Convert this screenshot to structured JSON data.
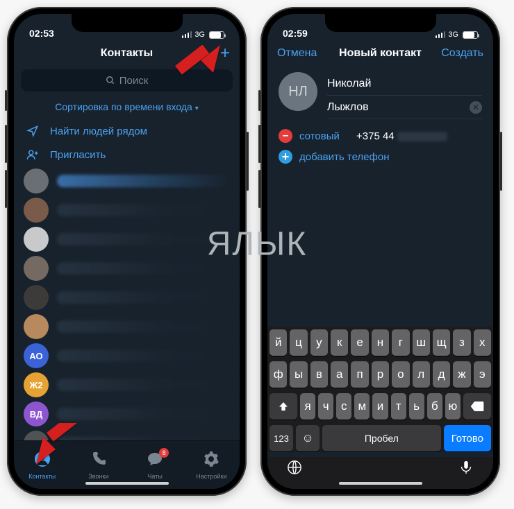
{
  "left": {
    "status": {
      "time": "02:53",
      "net": "3G"
    },
    "title": "Контакты",
    "search_placeholder": "Поиск",
    "sort_label": "Сортировка по времени входа",
    "find_nearby": "Найти людей рядом",
    "invite": "Пригласить",
    "contacts": [
      {
        "kind": "photo",
        "color": "#6b6f73",
        "highlight": true
      },
      {
        "kind": "photo",
        "color": "#7a5a48"
      },
      {
        "kind": "photo",
        "color": "#c7c9cb"
      },
      {
        "kind": "photo",
        "color": "#756a62"
      },
      {
        "kind": "photo",
        "color": "#3d3a3a"
      },
      {
        "kind": "photo",
        "color": "#b8895e"
      },
      {
        "kind": "initial",
        "color": "#3a63d8",
        "text": "АО"
      },
      {
        "kind": "initial",
        "color": "#e6a233",
        "text": "Ж2"
      },
      {
        "kind": "initial",
        "color": "#8e55d1",
        "text": "ВД"
      },
      {
        "kind": "photo",
        "color": "#4f5356"
      }
    ],
    "tabs": {
      "contacts": "Контакты",
      "calls": "Звонки",
      "chats": "Чаты",
      "chats_badge": "8",
      "settings": "Настройки"
    }
  },
  "right": {
    "status": {
      "time": "02:59",
      "net": "3G"
    },
    "cancel": "Отмена",
    "title": "Новый контакт",
    "create": "Создать",
    "initials": "НЛ",
    "first_name": "Николай",
    "last_name": "Лыжлов",
    "phone_type": "сотовый",
    "phone_value": "+375 44",
    "add_phone": "добавить телефон",
    "keyboard": {
      "row1": [
        "й",
        "ц",
        "у",
        "к",
        "е",
        "н",
        "г",
        "ш",
        "щ",
        "з",
        "х"
      ],
      "row2": [
        "ф",
        "ы",
        "в",
        "а",
        "п",
        "р",
        "о",
        "л",
        "д",
        "ж",
        "э"
      ],
      "row3": [
        "я",
        "ч",
        "с",
        "м",
        "и",
        "т",
        "ь",
        "б",
        "ю"
      ],
      "mode": "123",
      "space": "Пробел",
      "go": "Готово"
    }
  },
  "watermark": "ЯБЛЫК"
}
